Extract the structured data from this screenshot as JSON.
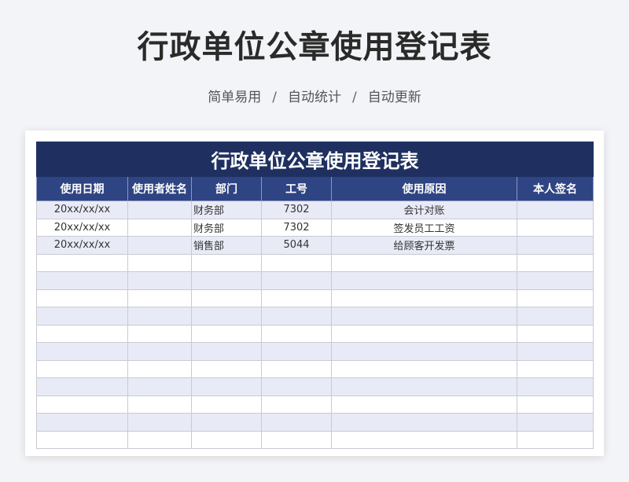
{
  "page": {
    "title": "行政单位公章使用登记表",
    "subtitle_parts": [
      "简单易用",
      "/",
      "自动统计",
      "/",
      "自动更新"
    ]
  },
  "table": {
    "banner_title": "行政单位公章使用登记表",
    "headers": [
      "使用日期",
      "使用者姓名",
      "部门",
      "工号",
      "使用原因",
      "本人签名"
    ],
    "rows": [
      [
        "20xx/xx/xx",
        "",
        "财务部",
        "7302",
        "会计对账",
        ""
      ],
      [
        "20xx/xx/xx",
        "",
        "财务部",
        "7302",
        "签发员工工资",
        ""
      ],
      [
        "20xx/xx/xx",
        "",
        "销售部",
        "5044",
        "给顾客开发票",
        ""
      ],
      [
        "",
        "",
        "",
        "",
        "",
        ""
      ],
      [
        "",
        "",
        "",
        "",
        "",
        ""
      ],
      [
        "",
        "",
        "",
        "",
        "",
        ""
      ],
      [
        "",
        "",
        "",
        "",
        "",
        ""
      ],
      [
        "",
        "",
        "",
        "",
        "",
        ""
      ],
      [
        "",
        "",
        "",
        "",
        "",
        ""
      ],
      [
        "",
        "",
        "",
        "",
        "",
        ""
      ],
      [
        "",
        "",
        "",
        "",
        "",
        ""
      ],
      [
        "",
        "",
        "",
        "",
        "",
        ""
      ],
      [
        "",
        "",
        "",
        "",
        "",
        ""
      ],
      [
        "",
        "",
        "",
        "",
        "",
        ""
      ]
    ]
  },
  "colors": {
    "banner": "#1f3060",
    "header": "#2e4483",
    "stripe": "#e8ebf6"
  }
}
